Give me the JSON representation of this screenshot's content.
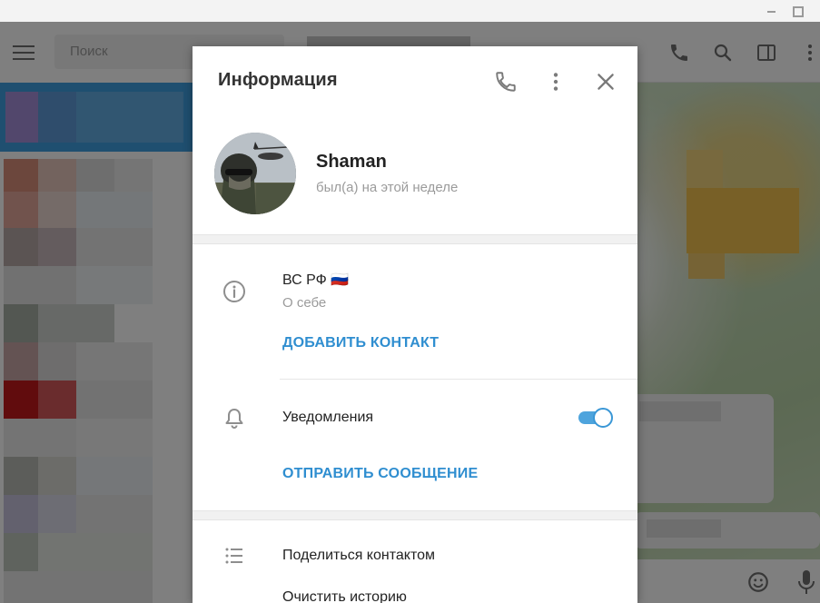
{
  "background": {
    "search": {
      "placeholder": "Поиск"
    }
  },
  "dialog": {
    "title": "Информация",
    "user": {
      "name": "Shaman",
      "status": "был(а) на этой неделе"
    },
    "bio": {
      "text": "ВС РФ 🇷🇺",
      "label": "О себе"
    },
    "add_contact_label": "ДОБАВИТЬ КОНТАКТ",
    "notifications": {
      "label": "Уведомления",
      "enabled": true
    },
    "send_message_label": "ОТПРАВИТЬ СООБЩЕНИЕ",
    "menu": {
      "share_contact": "Поделиться контактом",
      "clear_history": "Очистить историю"
    }
  },
  "colors": {
    "accent": "#2f8ed0",
    "toggle_on": "#4ea4dd",
    "active_chat": "#3f9fe0"
  }
}
